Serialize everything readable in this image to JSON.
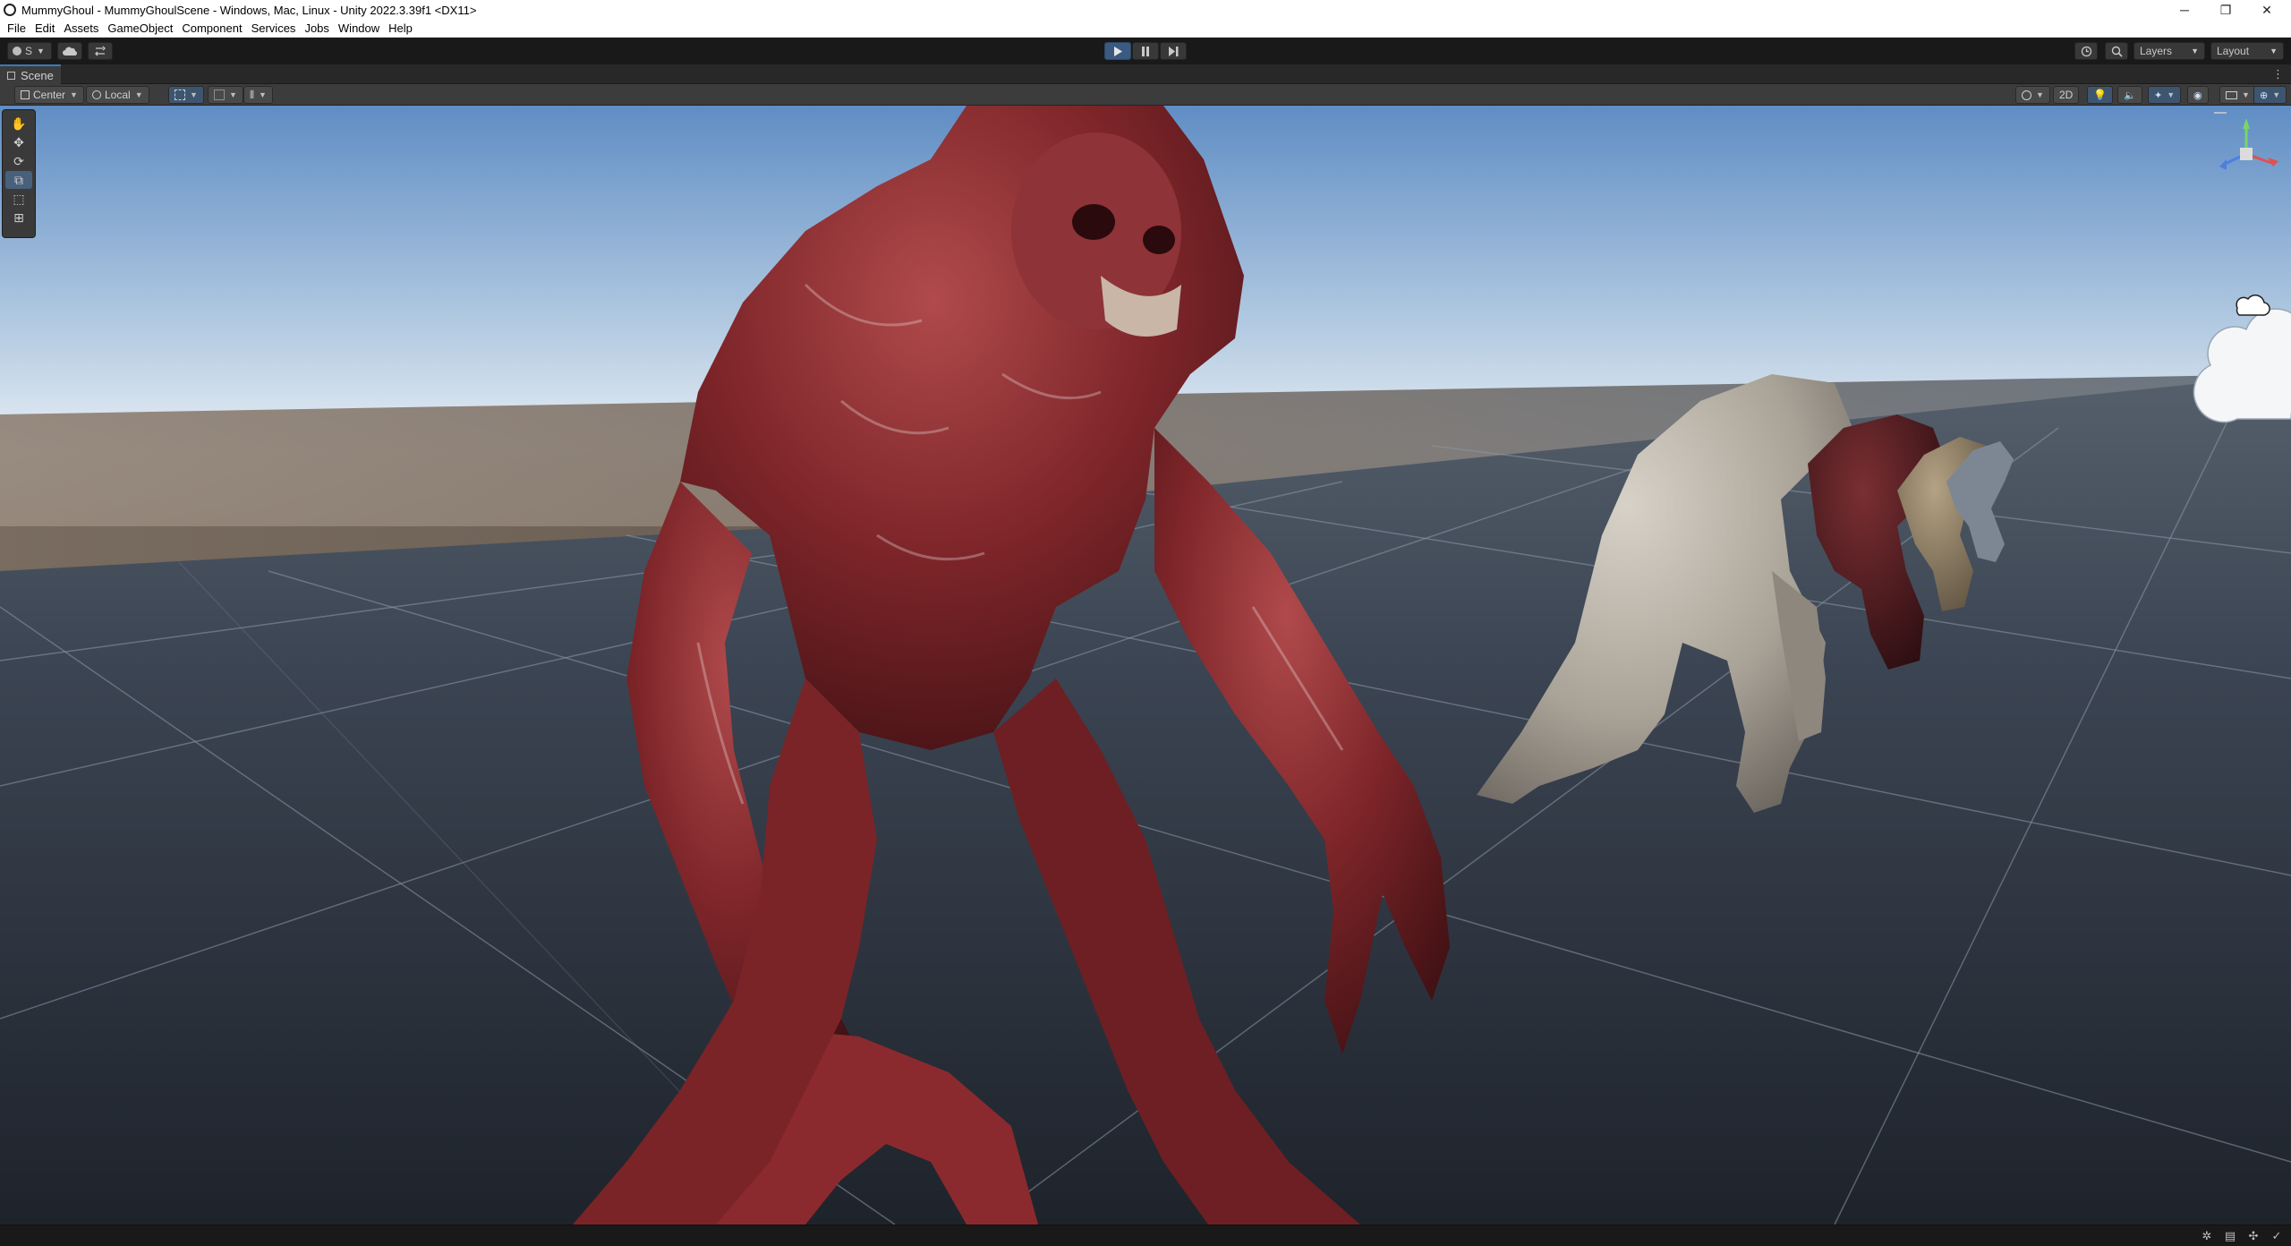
{
  "window": {
    "title": "MummyGhoul - MummyGhoulScene - Windows, Mac, Linux - Unity 2022.3.39f1 <DX11>",
    "minimize_glyph": "─",
    "restore_glyph": "❐",
    "close_glyph": "✕"
  },
  "menu": {
    "items": [
      "File",
      "Edit",
      "Assets",
      "GameObject",
      "Component",
      "Services",
      "Jobs",
      "Window",
      "Help"
    ]
  },
  "toolbar": {
    "account_label": "S",
    "layers_label": "Layers",
    "layout_label": "Layout",
    "play_icon": "play-icon",
    "pause_icon": "pause-icon",
    "step_icon": "step-icon",
    "accent": "#3a79bb"
  },
  "scene_tab": {
    "label": "Scene"
  },
  "scene_toolbar": {
    "pivot_label": "Center",
    "space_label": "Local",
    "mode_2d_label": "2D"
  },
  "tools": [
    "hand-tool",
    "move-tool",
    "rotate-tool",
    "scale-tool",
    "rect-tool",
    "transform-tool"
  ],
  "colors": {
    "sky_top": "#5f8dc4",
    "sky_horizon": "#e8eef4",
    "ground": "#3b4452",
    "creature_red": "#8a2a2e",
    "creature_bone": "#b3ada4"
  }
}
